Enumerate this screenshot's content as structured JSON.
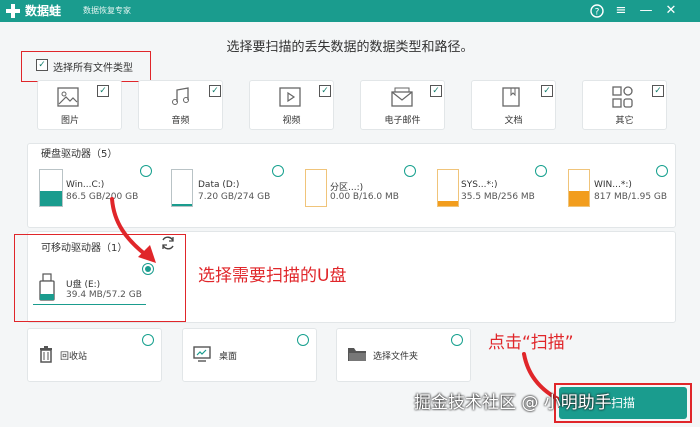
{
  "titlebar": {
    "app_name": "数据蛙",
    "app_subtitle": "数据恢复专家",
    "help_icon": "?",
    "menu_icon": "≡",
    "minimize_icon": "—",
    "close_icon": "✕"
  },
  "heading": "选择要扫描的丢失数据的数据类型和路径。",
  "select_all": {
    "label": "选择所有文件类型",
    "checked": true
  },
  "file_types": [
    {
      "label": "图片",
      "icon": "image-icon",
      "checked": true
    },
    {
      "label": "音频",
      "icon": "audio-icon",
      "checked": true
    },
    {
      "label": "视频",
      "icon": "video-icon",
      "checked": true
    },
    {
      "label": "电子邮件",
      "icon": "email-icon",
      "checked": true
    },
    {
      "label": "文档",
      "icon": "document-icon",
      "checked": true
    },
    {
      "label": "其它",
      "icon": "other-icon",
      "checked": true
    }
  ],
  "hard_drives": {
    "title": "硬盘驱动器（5）",
    "items": [
      {
        "name": "Win...C:)",
        "size": "86.5 GB/200 GB",
        "fill": 0.43
      },
      {
        "name": "Data (D:)",
        "size": "7.20 GB/274 GB",
        "fill": 0.03
      },
      {
        "name": "分区...:)",
        "size": "0.00  B/16.0 MB",
        "fill": 0.0
      },
      {
        "name": "SYS...*:)",
        "size": "35.5 MB/256 MB",
        "fill": 0.14
      },
      {
        "name": "WIN...*:)",
        "size": "817 MB/1.95 GB",
        "fill": 0.42
      }
    ]
  },
  "removable_drives": {
    "title": "可移动驱动器（1）",
    "refresh_icon": "refresh-icon",
    "items": [
      {
        "name": "U盘 (E:)",
        "size": "39.4 MB/57.2 GB",
        "selected": true
      }
    ]
  },
  "locations": [
    {
      "label": "回收站",
      "icon": "recycle-bin-icon"
    },
    {
      "label": "桌面",
      "icon": "desktop-icon"
    },
    {
      "label": "选择文件夹",
      "icon": "folder-icon"
    }
  ],
  "annotations": {
    "select_usb": "选择需要扫描的U盘",
    "click_scan": "点击“扫描”"
  },
  "scan_button": {
    "label": "扫描"
  },
  "watermark": "掘金技术社区 @ 小明助手"
}
